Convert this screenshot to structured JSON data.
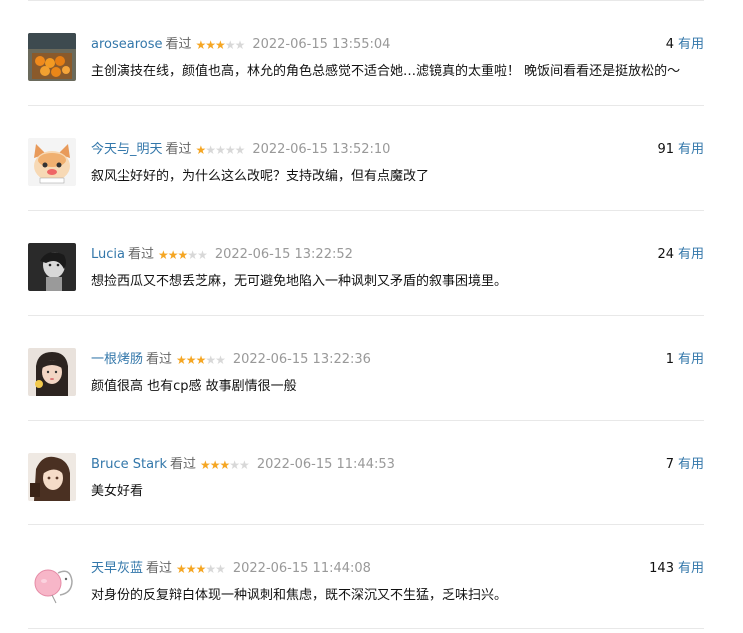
{
  "comments": [
    {
      "user": "arosearose",
      "status": "看过",
      "rating": 3,
      "time": "2022-06-15 13:55:04",
      "votes": "4",
      "vote_label": "有用",
      "text": "主创演技在线，颜值也高，林允的角色总感觉不适合她…滤镜真的太重啦！ 晚饭间看看还是挺放松的～",
      "avatar": "oranges-avatar"
    },
    {
      "user": "今天与_明天",
      "status": "看过",
      "rating": 1,
      "time": "2022-06-15 13:52:10",
      "votes": "91",
      "vote_label": "有用",
      "text": "叙风尘好好的，为什么这么改呢？支持改编，但有点魔改了",
      "avatar": "cat-avatar"
    },
    {
      "user": "Lucia",
      "status": "看过",
      "rating": 3,
      "time": "2022-06-15 13:22:52",
      "votes": "24",
      "vote_label": "有用",
      "text": "想捡西瓜又不想丢芝麻，无可避免地陷入一种讽刺又矛盾的叙事困境里。",
      "avatar": "bw-portrait-avatar"
    },
    {
      "user": "一根烤肠",
      "status": "看过",
      "rating": 3,
      "time": "2022-06-15 13:22:36",
      "votes": "1",
      "vote_label": "有用",
      "text": "颜值很高 也有cp感 故事剧情很一般",
      "avatar": "girl-avatar"
    },
    {
      "user": "Bruce Stark",
      "status": "看过",
      "rating": 3,
      "time": "2022-06-15 11:44:53",
      "votes": "7",
      "vote_label": "有用",
      "text": "美女好看",
      "avatar": "anime-avatar"
    },
    {
      "user": "天早灰蓝",
      "status": "看过",
      "rating": 3,
      "time": "2022-06-15 11:44:08",
      "votes": "143",
      "vote_label": "有用",
      "text": "对身份的反复辩白体现一种讽刺和焦虑，既不深沉又不生猛，乏味扫兴。",
      "avatar": "pink-pig-avatar"
    }
  ]
}
